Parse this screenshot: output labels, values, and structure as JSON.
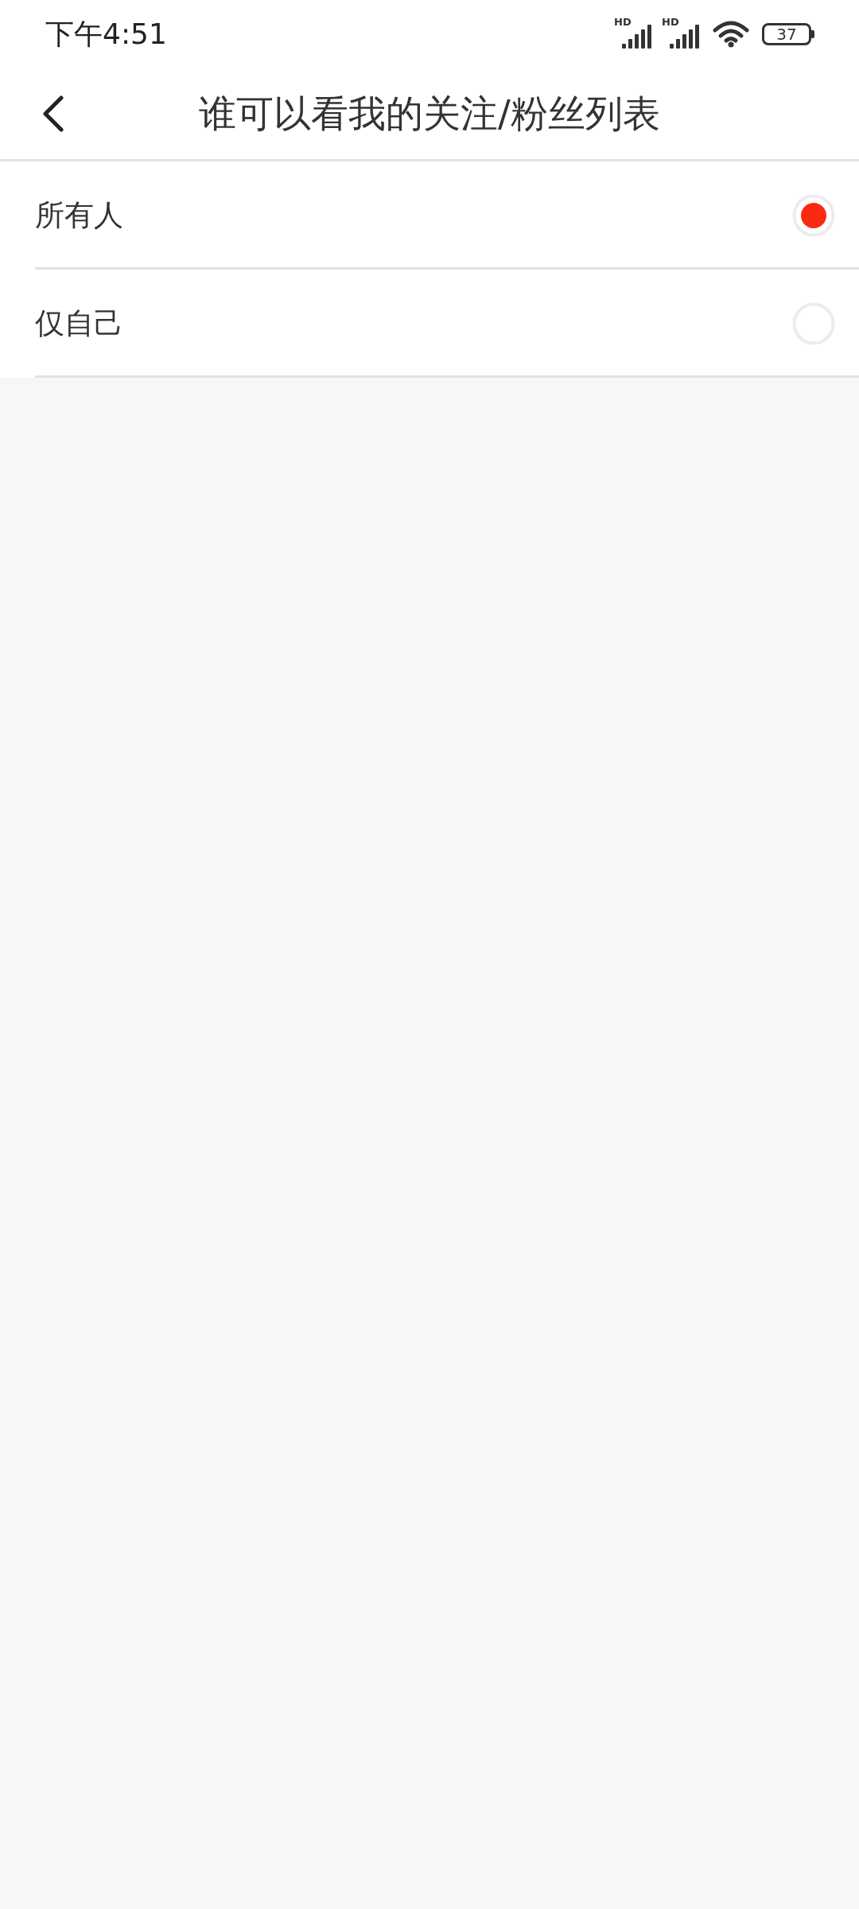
{
  "status_bar": {
    "time": "下午4:51",
    "networks": [
      {
        "label": "HD"
      },
      {
        "label": "HD"
      }
    ],
    "battery": "37"
  },
  "header": {
    "title": "谁可以看我的关注/粉丝列表"
  },
  "options": [
    {
      "label": "所有人",
      "selected": true
    },
    {
      "label": "仅自己",
      "selected": false
    }
  ]
}
